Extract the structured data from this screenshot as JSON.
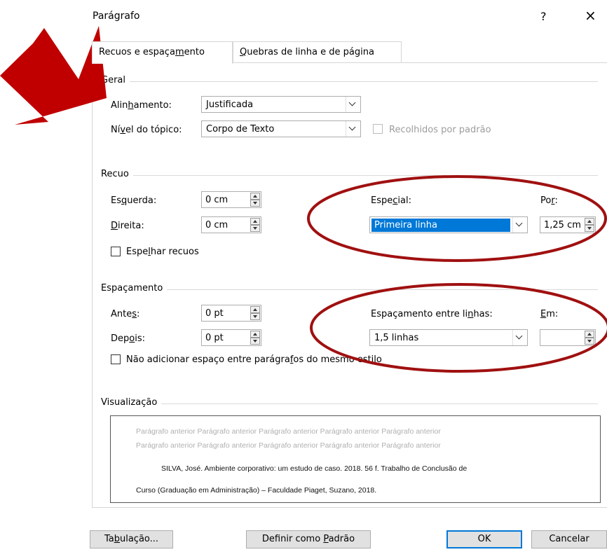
{
  "window": {
    "title": "Parágrafo",
    "help": "?",
    "close": "×"
  },
  "tabs": [
    {
      "label": "Recuos e espaçamento",
      "active": true
    },
    {
      "label": "Quebras de linha e de página",
      "active": false
    }
  ],
  "geral": {
    "section": "Geral",
    "alinhamento_label": "Alinhamento:",
    "alinhamento_value": "Justificada",
    "nivel_label": "Nível do tópico:",
    "nivel_value": "Corpo de Texto",
    "recolhidos_label": "Recolhidos por padrão"
  },
  "recuo": {
    "section": "Recuo",
    "esquerda_label": "Esquerda:",
    "esquerda_value": "0 cm",
    "direita_label": "Direita:",
    "direita_value": "0 cm",
    "especial_label": "Especial:",
    "especial_value": "Primeira linha",
    "por_label": "Por:",
    "por_value": "1,25 cm",
    "espelhar_label": "Espelhar recuos"
  },
  "espacamento": {
    "section": "Espaçamento",
    "antes_label": "Antes:",
    "antes_value": "0 pt",
    "depois_label": "Depois:",
    "depois_value": "0 pt",
    "entre_linhas_label": "Espaçamento entre linhas:",
    "entre_linhas_value": "1,5 linhas",
    "em_label": "Em:",
    "em_value": "",
    "nao_adicionar_label": "Não adicionar espaço entre parágrafos do mesmo estilo"
  },
  "visualizacao": {
    "section": "Visualização",
    "prev_line_1": "Parágrafo anterior Parágrafo anterior Parágrafo anterior Parágrafo anterior Parágrafo anterior",
    "prev_line_2": "Parágrafo anterior Parágrafo anterior Parágrafo anterior Parágrafo anterior Parágrafo anterior",
    "sample_line_1": "SILVA, José. Ambiente corporativo: um estudo de caso. 2018. 56 f. Trabalho de Conclusão de",
    "sample_line_2": "Curso (Graduação em Administração) – Faculdade Piaget, Suzano, 2018."
  },
  "buttons": {
    "tabulacao": "Tabulação...",
    "definir_padrao": "Definir como Padrão",
    "ok": "OK",
    "cancelar": "Cancelar"
  },
  "annotation_colors": {
    "arrow": "#c00000",
    "ellipse": "#a01010"
  }
}
